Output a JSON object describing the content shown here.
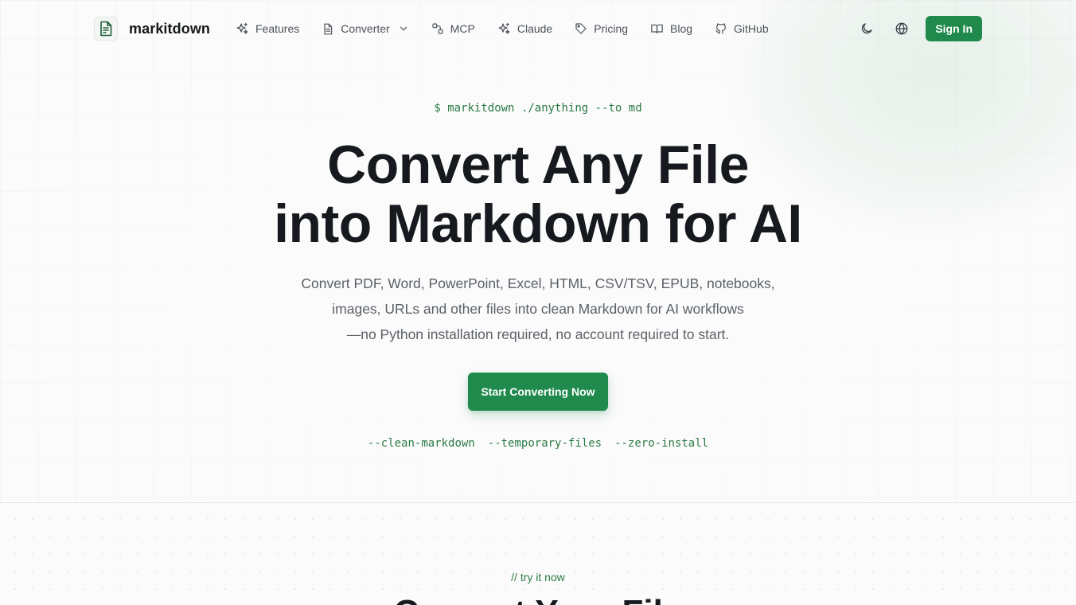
{
  "brand": {
    "name": "markitdown"
  },
  "nav": {
    "items": [
      {
        "label": "Features",
        "icon": "sparkles-icon"
      },
      {
        "label": "Converter",
        "icon": "document-icon",
        "dropdown": true
      },
      {
        "label": "MCP",
        "icon": "nodes-icon"
      },
      {
        "label": "Claude",
        "icon": "sparkles-icon"
      },
      {
        "label": "Pricing",
        "icon": "tag-icon"
      },
      {
        "label": "Blog",
        "icon": "book-icon"
      },
      {
        "label": "GitHub",
        "icon": "github-icon"
      }
    ],
    "actions": {
      "theme_icon": "moon-icon",
      "language_icon": "globe-icon",
      "signin_label": "Sign In"
    }
  },
  "hero": {
    "command": "$ markitdown ./anything --to md",
    "headline_line1": "Convert Any File",
    "headline_line2": "into Markdown for AI",
    "subtitle_line1": "Convert PDF, Word, PowerPoint, Excel, HTML, CSV/TSV, EPUB, notebooks,",
    "subtitle_line2": "images, URLs and other files into clean Markdown for AI workflows",
    "subtitle_line3": "—no Python installation required, no account required to start.",
    "cta_label": "Start Converting Now",
    "flags": [
      "--clean-markdown",
      "--temporary-files",
      "--zero-install"
    ]
  },
  "try_section": {
    "eyebrow": "// try it now",
    "title": "Convert Your File"
  },
  "colors": {
    "accent": "#1f8a4c",
    "accent_text": "#2b7a45",
    "heading": "#16191d",
    "body": "#5b6168"
  }
}
